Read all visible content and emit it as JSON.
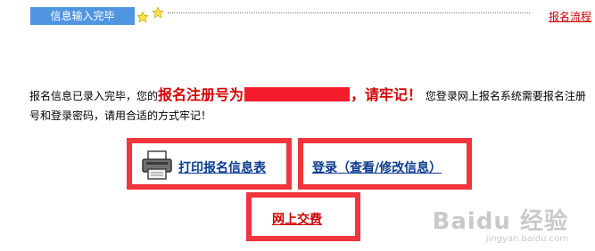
{
  "tab": {
    "label": "信息输入完毕"
  },
  "header": {
    "process_link": "报名流程"
  },
  "message": {
    "part1": "报名信息已录入完毕，您的",
    "emph1": "报名注册号为",
    "emph2": "，请牢记！",
    "part2": " 您登录网上报名系统需要报名注册号和登录密码，请用合适的方式牢记！"
  },
  "actions": {
    "print": "打印报名信息表",
    "login": "登录（查看/修改信息）",
    "pay": "网上交费"
  },
  "watermark": {
    "brand": "Baidu 经验",
    "url": "jingyan.baidu.com"
  },
  "colors": {
    "tab_blue": "#4f95e0",
    "highlight_red": "#f0353f",
    "emphasis_red": "#d40000",
    "link_blue": "#0b3b8f"
  }
}
